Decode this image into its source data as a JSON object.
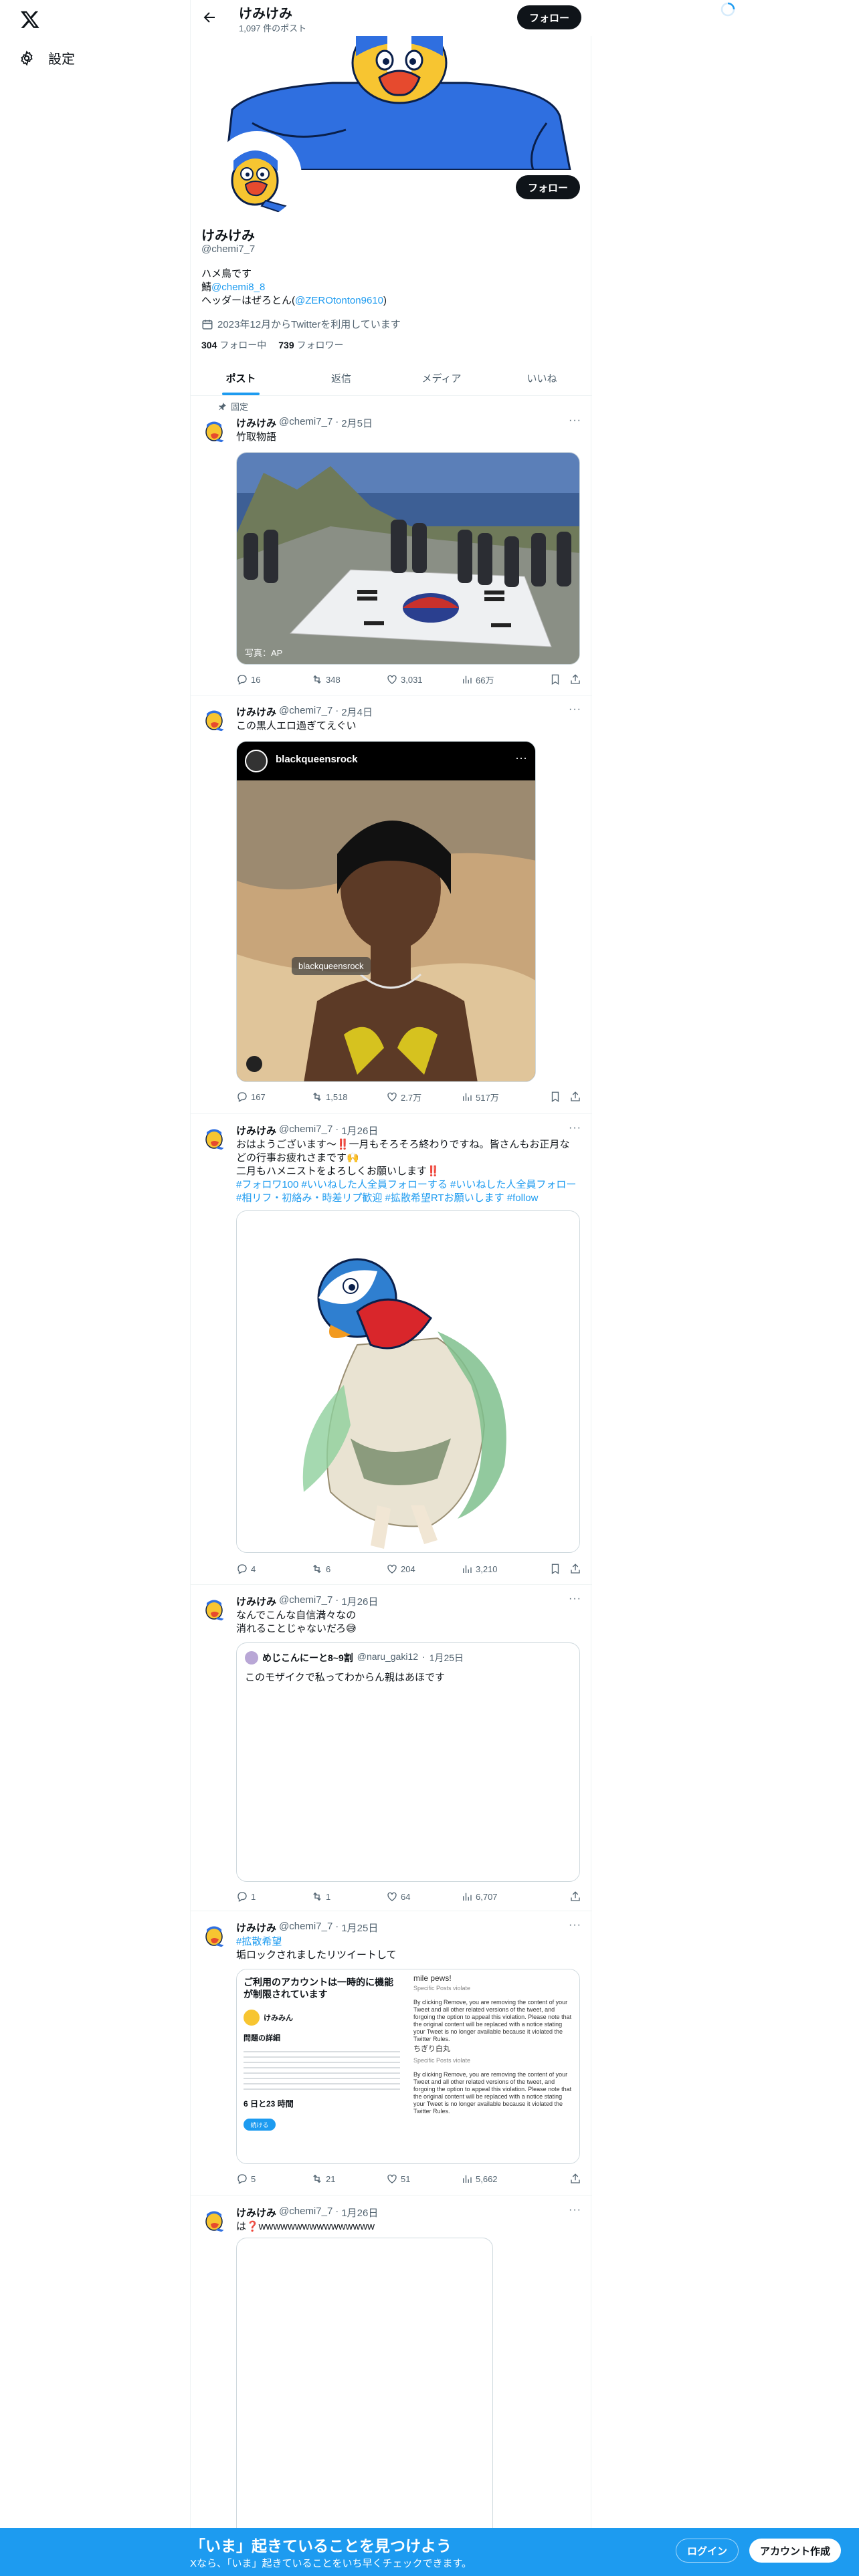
{
  "nav": {
    "settings_label": "設定"
  },
  "header": {
    "name": "けみけみ",
    "post_count": "1,097 件のポスト",
    "follow_label": "フォロー"
  },
  "profile": {
    "name": "けみけみ",
    "handle": "@chemi7_7",
    "bio_line1": "ハメ鳥です",
    "bio_line2_prefix": "鯖",
    "bio_line2_link": "@chemi8_8",
    "bio_line3_prefix": "ヘッダーはぜろとん(",
    "bio_line3_link": "@ZEROtonton9610",
    "bio_line3_suffix": ")",
    "joined": "2023年12月からTwitterを利用しています",
    "following_count": "304",
    "following_label": "フォロー中",
    "followers_count": "739",
    "followers_label": "フォロワー",
    "follow_label": "フォロー"
  },
  "tabs": [
    {
      "label": "ポスト"
    },
    {
      "label": "返信"
    },
    {
      "label": "メディア"
    },
    {
      "label": "いいね"
    }
  ],
  "tweets": [
    {
      "pinned": "固定",
      "name": "けみけみ",
      "handle": "@chemi7_7",
      "dot": "·",
      "date": "2月5日",
      "text": "竹取物語",
      "media_caption": "写真：AP",
      "reply": "16",
      "retweet": "348",
      "like": "3,031",
      "views": "66万"
    },
    {
      "name": "けみけみ",
      "handle": "@chemi7_7",
      "dot": "·",
      "date": "2月4日",
      "text": "この黒人エロ過ぎてえぐい",
      "embed_account": "blackqueensrock",
      "embed_label": "blackqueensrock",
      "reply": "167",
      "retweet": "1,518",
      "like": "2.7万",
      "views": "517万"
    },
    {
      "name": "けみけみ",
      "handle": "@chemi7_7",
      "dot": "·",
      "date": "1月26日",
      "text_l1": "おはようございます〜‼️一月もそろそろ終わりですね。皆さんもお正月な",
      "text_l2": "どの行事お疲れさまです🙌",
      "text_l3": "二月もハメニストをよろしくお願いします‼️",
      "tags_l1": "#フォロワ100 #いいねした人全員フォローする #いいねした人全員フォロー",
      "tags_l2": "#相リフ・初絡み・時差リプ歓迎 #拡散希望RTお願いします #follow",
      "reply": "4",
      "retweet": "6",
      "like": "204",
      "views": "3,210"
    },
    {
      "name": "けみけみ",
      "handle": "@chemi7_7",
      "dot": "·",
      "date": "1月26日",
      "text_l1": "なんでこんな自信満々なの",
      "text_l2": "消れることじゃないだろ😅",
      "quote_name": "めじこんにーと8~9割",
      "quote_handle": "@naru_gaki12",
      "quote_date": "1月25日",
      "quote_text": "このモザイクで私ってわからん親はあほです",
      "reply": "1",
      "retweet": "1",
      "like": "64",
      "views": "6,707"
    },
    {
      "name": "けみけみ",
      "handle": "@chemi7_7",
      "dot": "·",
      "date": "1月25日",
      "text_tag": "#拡散希望",
      "text_l2": "垢ロックされましたリツイートして",
      "shot_title": "ご利用のアカウントは一時的に機能が制限されています",
      "shot_user": "けみみん",
      "shot_section": "問題の詳細",
      "shot_time": "6 日と23 時間",
      "shot_btn": "続ける",
      "shot_right_top": "mile pews!",
      "shot_right_small": "Specific Posts violate",
      "shot_para": "By clicking Remove, you are removing the content of your Tweet and all other related versions of the tweet, and forgoing the option to appeal this violation. Please note that the original content will be replaced with a notice stating your Tweet is no longer available because it violated the Twitter Rules.",
      "shot_chosen": "ちぎり白丸",
      "reply": "5",
      "retweet": "21",
      "like": "51",
      "views": "5,662"
    },
    {
      "name": "けみけみ",
      "handle": "@chemi7_7",
      "dot": "·",
      "date": "1月26日",
      "text": "は❓wwwwwwwwwwwwwwww"
    }
  ],
  "bottom_bar": {
    "title": "「いま」起きていることを見つけよう",
    "subtitle": "Xなら、「いま」起きていることをいち早くチェックできます。",
    "login": "ログイン",
    "signup": "アカウント作成"
  },
  "colors": {
    "accent": "#1d9bf0",
    "text": "#0f1419",
    "muted": "#536471"
  }
}
